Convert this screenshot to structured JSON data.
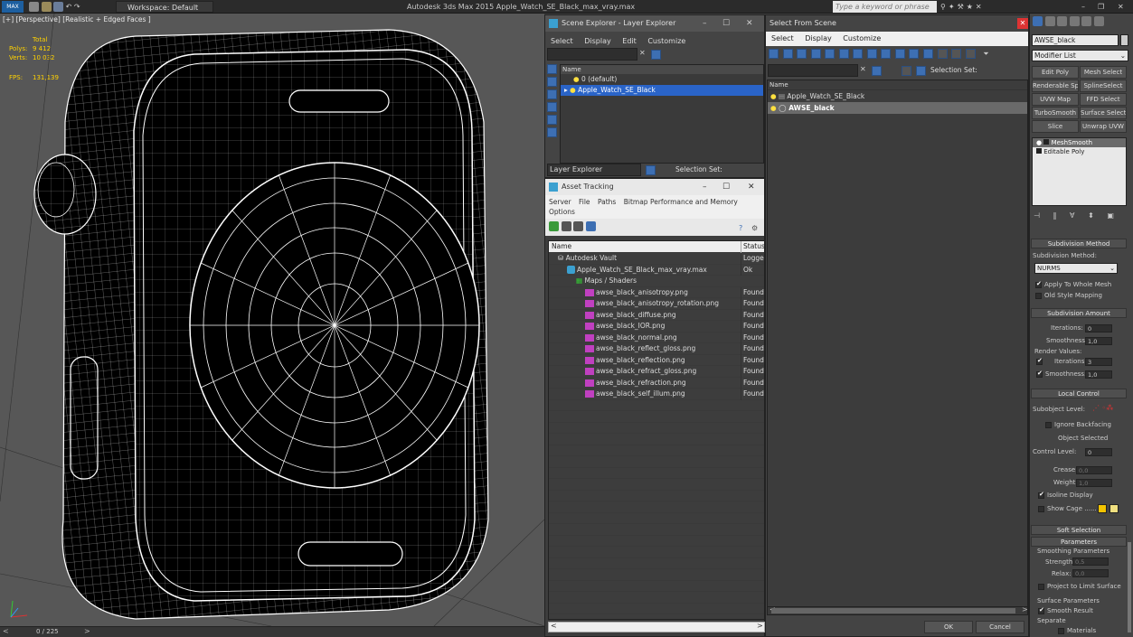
{
  "titlebar": {
    "app_icon": "MAX",
    "workspace": "Workspace: Default",
    "title": "Autodesk 3ds Max  2015     Apple_Watch_SE_Black_max_vray.max",
    "search_placeholder": "Type a keyword or phrase"
  },
  "viewport": {
    "label": "[+] [Perspective] [Realistic + Edged Faces ]",
    "stats": {
      "total_label": "Total",
      "polys_label": "Polys:",
      "polys_value": "9 412",
      "verts_label": "Verts:",
      "verts_value": "10 032",
      "fps_label": "FPS:",
      "fps_value": "131,139"
    }
  },
  "timeline": {
    "frame": "0 / 225"
  },
  "scene_explorer": {
    "title": "Scene Explorer - Layer Explorer",
    "menu": [
      "Select",
      "Display",
      "Edit",
      "Customize"
    ],
    "column_name": "Name",
    "items": [
      "0 (default)",
      "Apple_Watch_SE_Black"
    ],
    "footer_label": "Layer Explorer",
    "selection_set": "Selection Set:"
  },
  "asset_tracking": {
    "title": "Asset Tracking",
    "menu": [
      "Server",
      "File",
      "Paths",
      "Bitmap Performance and Memory",
      "Options"
    ],
    "col_name": "Name",
    "col_status": "Status",
    "rows": [
      {
        "name": "Autodesk Vault",
        "status": "Logged",
        "indent": 1
      },
      {
        "name": "Apple_Watch_SE_Black_max_vray.max",
        "status": "Ok",
        "indent": 2
      },
      {
        "name": "Maps / Shaders",
        "status": "",
        "indent": 3
      },
      {
        "name": "awse_black_anisotropy.png",
        "status": "Found",
        "indent": 4
      },
      {
        "name": "awse_black_anisotropy_rotation.png",
        "status": "Found",
        "indent": 4
      },
      {
        "name": "awse_black_diffuse.png",
        "status": "Found",
        "indent": 4
      },
      {
        "name": "awse_black_IOR.png",
        "status": "Found",
        "indent": 4
      },
      {
        "name": "awse_black_normal.png",
        "status": "Found",
        "indent": 4
      },
      {
        "name": "awse_black_reflect_gloss.png",
        "status": "Found",
        "indent": 4
      },
      {
        "name": "awse_black_reflection.png",
        "status": "Found",
        "indent": 4
      },
      {
        "name": "awse_black_refract_gloss.png",
        "status": "Found",
        "indent": 4
      },
      {
        "name": "awse_black_refraction.png",
        "status": "Found",
        "indent": 4
      },
      {
        "name": "awse_black_self_illum.png",
        "status": "Found",
        "indent": 4
      }
    ]
  },
  "select_from_scene": {
    "title": "Select From Scene",
    "menu": [
      "Select",
      "Display",
      "Customize"
    ],
    "selection_set": "Selection Set:",
    "column_name": "Name",
    "items": [
      "Apple_Watch_SE_Black",
      "AWSE_black"
    ],
    "ok": "OK",
    "cancel": "Cancel"
  },
  "command_panel": {
    "object_name": "AWSE_black",
    "modifier_list": "Modifier List",
    "buttons": [
      "Edit Poly",
      "Mesh Select",
      "Renderable Spline",
      "SplineSelect",
      "UVW Map",
      "FFD Select",
      "TurboSmooth",
      "Surface Select",
      "Slice",
      "Unwrap UVW"
    ],
    "stack": [
      "MeshSmooth",
      "Editable Poly"
    ],
    "subdivision_method_title": "Subdivision Method",
    "subdivision_method_label": "Subdivision Method:",
    "subdivision_method_value": "NURMS",
    "apply_whole_mesh": "Apply To Whole Mesh",
    "old_style_mapping": "Old Style Mapping",
    "subdivision_amount_title": "Subdivision Amount",
    "iterations_label": "Iterations:",
    "iterations_value": "0",
    "smoothness_label": "Smoothness:",
    "smoothness_value": "1,0",
    "render_values_label": "Render Values:",
    "render_iterations_value": "3",
    "render_smoothness_value": "1,0",
    "local_control_title": "Local Control",
    "subobject_level_label": "Subobject Level:",
    "ignore_backfacing": "Ignore Backfacing",
    "object_selected": "Object Selected",
    "control_level_label": "Control Level:",
    "control_level_value": "0",
    "crease_label": "Crease:",
    "crease_value": "0,0",
    "weight_label": "Weight:",
    "weight_value": "1,0",
    "isoline_display": "Isoline Display",
    "show_cage": "Show Cage ......",
    "cage_color_1": "#f3c400",
    "cage_color_2": "#f0e080",
    "soft_selection_title": "Soft Selection",
    "parameters_title": "Parameters",
    "smoothing_parameters": "Smoothing Parameters",
    "strength_label": "Strength:",
    "strength_value": "0,5",
    "relax_label": "Relax:",
    "relax_value": "0,0",
    "project_limit": "Project to Limit Surface",
    "surface_parameters": "Surface Parameters",
    "smooth_result": "Smooth Result",
    "separate_label": "Separate",
    "materials_label": "Materials"
  }
}
